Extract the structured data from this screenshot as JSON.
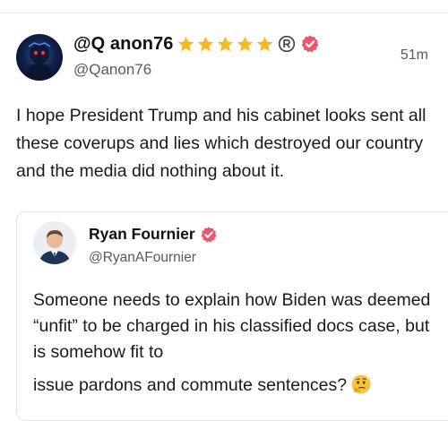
{
  "post": {
    "author": {
      "display_name": "@Q anon76",
      "handle": "@Qanon76",
      "avatar_icon": "avatar-icon",
      "badges": [
        "star-icon",
        "star-icon",
        "star-icon",
        "star-icon",
        "star-icon",
        "registered-icon",
        "verified-badge-icon"
      ]
    },
    "time": "51m",
    "text": "I hope President Trump and his cabinet looks sent all these coverups and lies which destroyed our country and the media did nothing about it."
  },
  "quoted_post": {
    "author": {
      "display_name": "Ryan Fournier",
      "handle": "@RyanAFournier",
      "avatar_icon": "avatar-icon"
    },
    "text_main": "Someone needs to explain how Biden was deemed “unfit” to be charged in his classified docs case, but is somehow fit to",
    "text_last": "issue pardons and commute sentences?",
    "emoji": "thinking-face-icon"
  },
  "colors": {
    "star": "#f5b921",
    "verified": "#f0556b",
    "secondary_text": "#555b61",
    "border": "#e1e4e8"
  }
}
